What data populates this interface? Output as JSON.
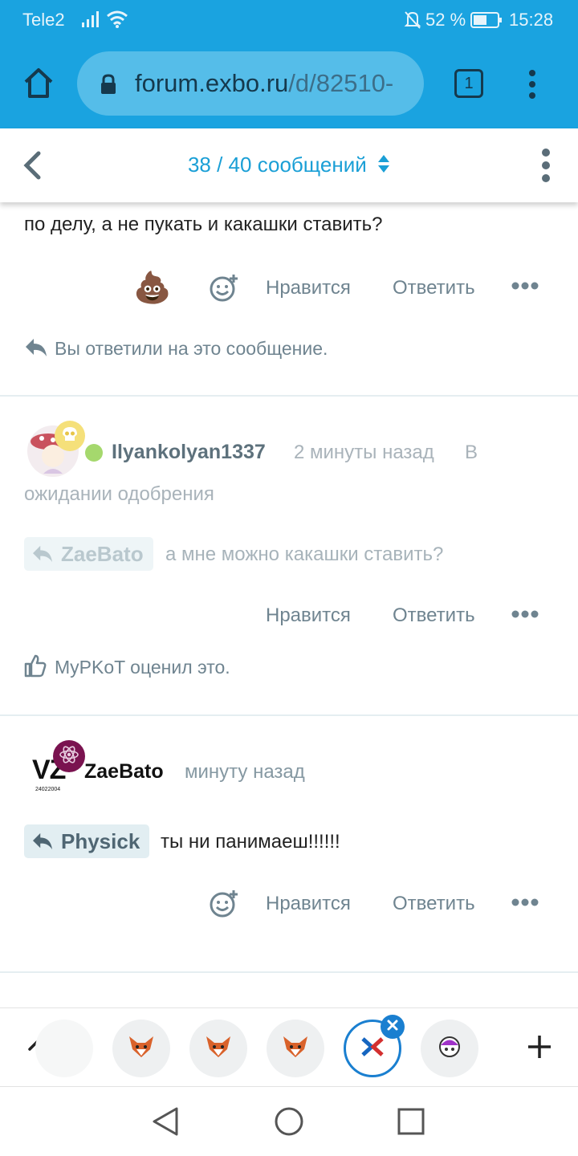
{
  "status_bar": {
    "carrier": "Tele2",
    "battery": "52 %",
    "time": "15:28"
  },
  "browser": {
    "url_host": "forum.exbo.ru",
    "url_path": "/d/82510-",
    "tab_count": "1"
  },
  "forum_header": {
    "title": "38 / 40 сообщений"
  },
  "post_top": {
    "text": "по делу, а не пукать и какашки ставить?",
    "reaction_emoji": "💩",
    "like_label": "Нравится",
    "reply_label": "Ответить",
    "replied_note": "Вы ответили на это сообщение."
  },
  "post_2": {
    "author": "Ilyankolyan1337",
    "time": "2 минуты назад",
    "status_part1": "В",
    "status_part2": "ожидании одобрения",
    "reply_to": "ZaeBato",
    "text": "а мне можно какашки ставить?",
    "like_label": "Нравится",
    "reply_label": "Ответить",
    "liked_note": "MyPKoT оценил это."
  },
  "post_3": {
    "author": "ZaeBato",
    "avatar_text": "VZ",
    "avatar_subtext": "24022004",
    "time": "минуту назад",
    "reply_to": "Physick",
    "text": "ты ни панимаеш!!!!!!",
    "like_label": "Нравится",
    "reply_label": "Ответить"
  },
  "colors": {
    "browser_bar": "#1aa3e0",
    "accent": "#1a9fd6",
    "action_gray": "#6f8490",
    "online_green": "#a5d86d"
  }
}
